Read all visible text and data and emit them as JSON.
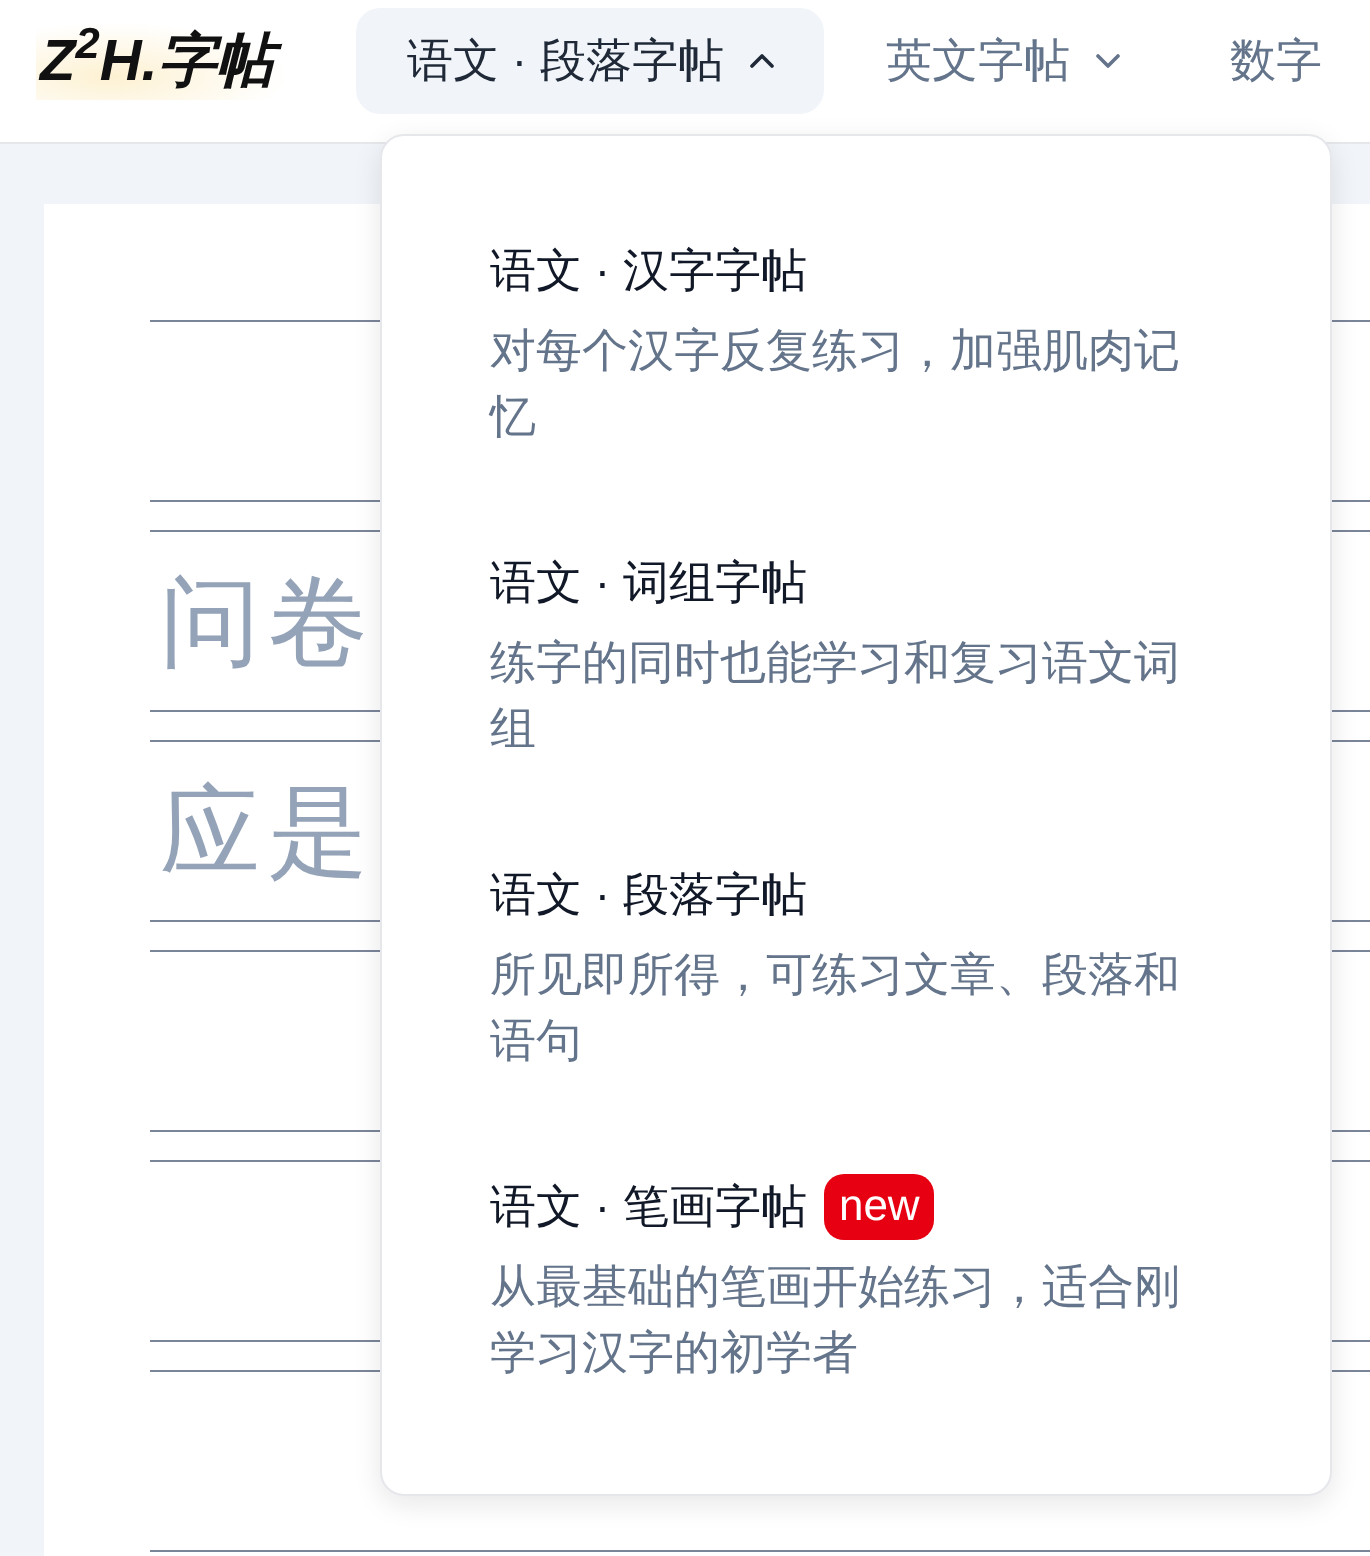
{
  "logo": {
    "text": "Z$^{2}$H.字帖"
  },
  "nav": [
    {
      "label": "语文 · 段落字帖",
      "selected": true,
      "expanded": true,
      "menu": [
        {
          "title": "语文 · 汉字字帖",
          "description": "对每个汉字反复练习，加强肌肉记忆"
        },
        {
          "title": "语文 · 词组字帖",
          "description": "练字的同时也能学习和复习语文词组"
        },
        {
          "title": "语文 · 段落字帖",
          "description": "所见即所得，可练习文章、段落和语句"
        },
        {
          "title": "语文 · 笔画字帖",
          "badge": "new",
          "description": "从最基础的笔画开始练习，适合刚学习汉字的初学者"
        }
      ]
    },
    {
      "label": "英文字帖",
      "selected": false,
      "expanded": false
    },
    {
      "label": "数字",
      "selected": false
    }
  ],
  "practice_sheet": {
    "lines": [
      "问卷",
      "应是"
    ]
  }
}
